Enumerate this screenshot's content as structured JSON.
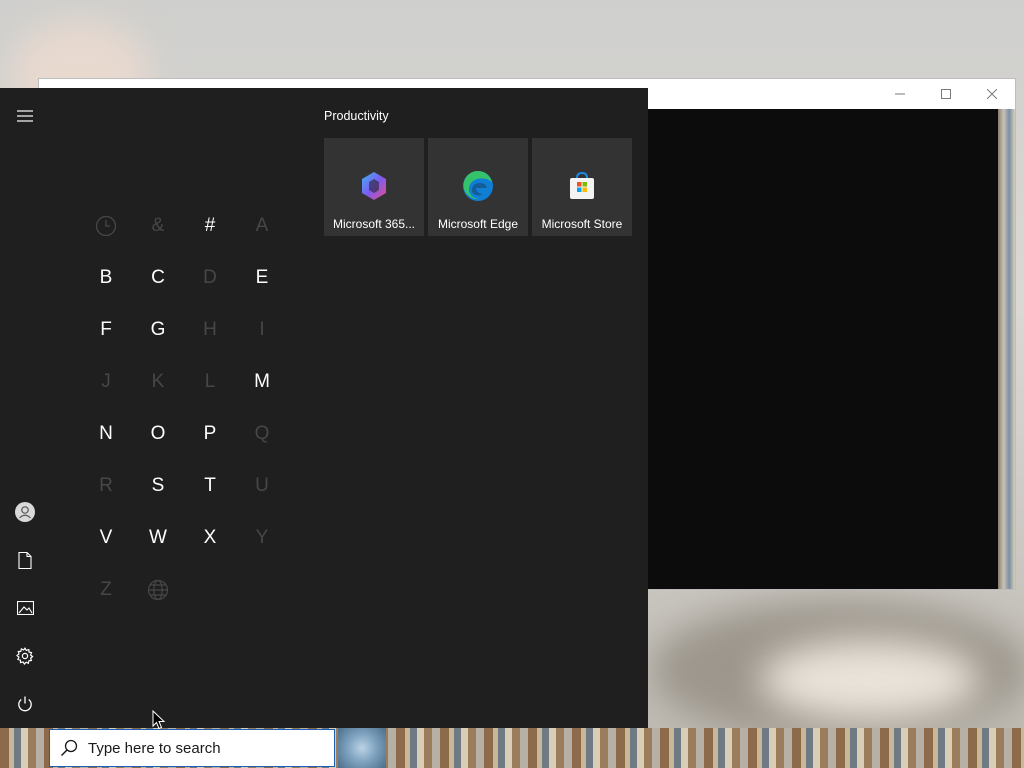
{
  "window": {
    "minimize_icon": "minimize-icon",
    "maximize_icon": "maximize-icon",
    "close_icon": "close-icon"
  },
  "start_menu": {
    "rail": {
      "menu_icon": "hamburger-icon",
      "items": [
        {
          "name": "account",
          "icon": "user-icon"
        },
        {
          "name": "documents",
          "icon": "document-icon"
        },
        {
          "name": "pictures",
          "icon": "picture-icon"
        },
        {
          "name": "settings",
          "icon": "gear-icon"
        },
        {
          "name": "power",
          "icon": "power-icon"
        }
      ]
    },
    "alphabet": [
      {
        "label": "",
        "icon": "clock-icon",
        "enabled": false
      },
      {
        "label": "&",
        "enabled": false
      },
      {
        "label": "#",
        "enabled": true
      },
      {
        "label": "A",
        "enabled": false
      },
      {
        "label": "B",
        "enabled": true
      },
      {
        "label": "C",
        "enabled": true
      },
      {
        "label": "D",
        "enabled": false
      },
      {
        "label": "E",
        "enabled": true
      },
      {
        "label": "F",
        "enabled": true
      },
      {
        "label": "G",
        "enabled": true
      },
      {
        "label": "H",
        "enabled": false
      },
      {
        "label": "I",
        "enabled": false
      },
      {
        "label": "J",
        "enabled": false
      },
      {
        "label": "K",
        "enabled": false
      },
      {
        "label": "L",
        "enabled": false
      },
      {
        "label": "M",
        "enabled": true
      },
      {
        "label": "N",
        "enabled": true
      },
      {
        "label": "O",
        "enabled": true
      },
      {
        "label": "P",
        "enabled": true
      },
      {
        "label": "Q",
        "enabled": false
      },
      {
        "label": "R",
        "enabled": false
      },
      {
        "label": "S",
        "enabled": true
      },
      {
        "label": "T",
        "enabled": true
      },
      {
        "label": "U",
        "enabled": false
      },
      {
        "label": "V",
        "enabled": true
      },
      {
        "label": "W",
        "enabled": true
      },
      {
        "label": "X",
        "enabled": true
      },
      {
        "label": "Y",
        "enabled": false
      },
      {
        "label": "Z",
        "enabled": false
      },
      {
        "label": "",
        "icon": "globe-icon",
        "enabled": false
      }
    ],
    "group_title": "Productivity",
    "tiles": [
      {
        "label": "Microsoft 365...",
        "icon": "microsoft-365-icon"
      },
      {
        "label": "Microsoft Edge",
        "icon": "edge-icon"
      },
      {
        "label": "Microsoft Store",
        "icon": "store-icon"
      }
    ]
  },
  "taskbar": {
    "search_placeholder": "Type here to search",
    "search_icon": "search-icon"
  },
  "colors": {
    "start_bg": "#1f1f1f",
    "tile_bg": "#333333",
    "disabled_letter": "#474747",
    "search_border": "#1c5fb2"
  }
}
